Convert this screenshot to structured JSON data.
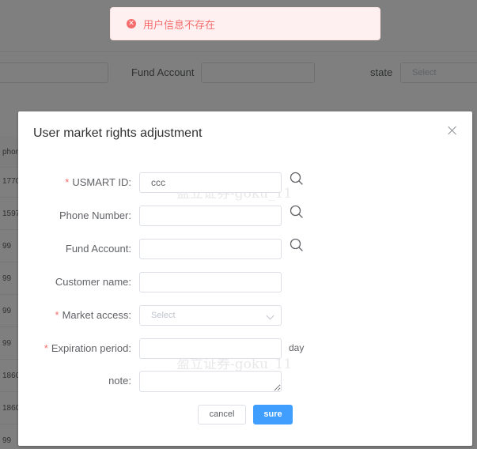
{
  "background": {
    "fund_account_label": "Fund Account",
    "state_label": "state",
    "state_placeholder": "Select",
    "table_header_partial": "phon",
    "table_cells_partial": [
      "1770",
      "1597",
      "99",
      "99",
      "99",
      "99",
      "1860",
      "1860",
      "99"
    ]
  },
  "watermark": {
    "text": "盈立证券-goku_11"
  },
  "toast": {
    "type": "error",
    "message": "用户信息不存在",
    "icon": "close-circle-icon",
    "color": "#f56c6c"
  },
  "dialog": {
    "title": "User market rights adjustment",
    "close_icon": "close-icon",
    "fields": {
      "usmart_id": {
        "label": "USMART ID:",
        "value": "ccc",
        "required": true,
        "icon": "search-icon"
      },
      "phone_number": {
        "label": "Phone Number:",
        "value": "",
        "required": false,
        "icon": "search-icon"
      },
      "fund_account": {
        "label": "Fund Account:",
        "value": "",
        "required": false,
        "icon": "search-icon"
      },
      "customer_name": {
        "label": "Customer name:",
        "value": "",
        "required": false
      },
      "market_access": {
        "label": "Market access:",
        "placeholder": "Select",
        "required": true
      },
      "expiration_period": {
        "label": "Expiration period:",
        "value": "",
        "unit": "day",
        "required": true
      },
      "note": {
        "label": "note:",
        "value": "",
        "required": false
      }
    },
    "buttons": {
      "cancel": "cancel",
      "sure": "sure"
    },
    "required_mark": "*"
  },
  "colors": {
    "primary": "#409eff",
    "danger": "#f56c6c",
    "overlay": "rgba(0,0,0,0.5)"
  }
}
